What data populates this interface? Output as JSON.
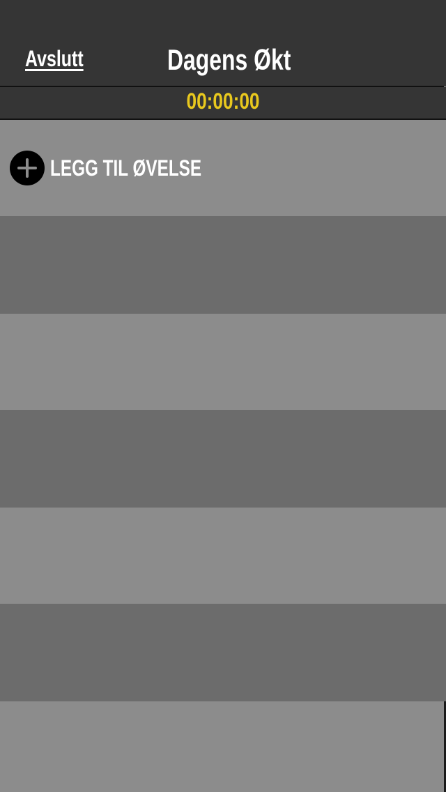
{
  "header": {
    "back_label": "Avslutt",
    "title": "Dagens Økt"
  },
  "timer": {
    "value": "00:00:00"
  },
  "workout": {
    "add_exercise_label": "LEGG TIL ØVELSE",
    "add_icon": "plus-circle-icon"
  },
  "colors": {
    "header_bg": "#353535",
    "timer_text": "#e8c81e",
    "row_light": "#8c8c8c",
    "row_dark": "#6c6c6c"
  }
}
